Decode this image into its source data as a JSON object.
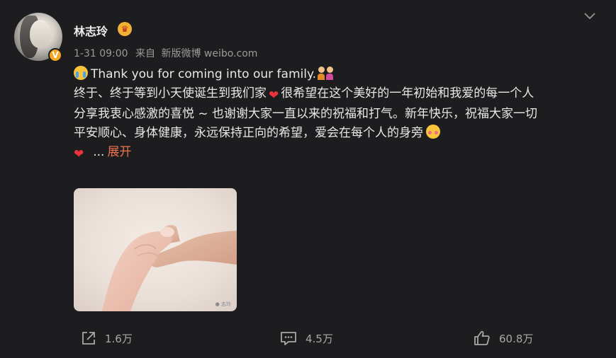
{
  "post": {
    "author": {
      "name": "林志玲",
      "verified_badge": "V",
      "crown_icon": "crown-badge-icon"
    },
    "meta": {
      "time": "1-31 09:00",
      "source_prefix": "来自",
      "source": "新版微博 weibo.com"
    },
    "content": {
      "line1": "Thank you for coming into our family.",
      "line2a": "终于、终于等到小天使诞生到我们家",
      "line2b": "很希望在这个美好的一年初始和我爱的每一个人",
      "line3": "分享我衷心感激的喜悦 ~ 也谢谢大家一直以来的祝福和打气。新年快乐，祝福大家一切",
      "line4": "平安顺心、身体健康，永远保持正向的希望，爱会在每个人的身旁",
      "ellipsis": "...",
      "expand_label": "展开"
    },
    "photo": {
      "watermark": "● 志玲"
    },
    "actions": {
      "share_count": "1.6万",
      "comment_count": "4.5万",
      "like_count": "60.8万"
    }
  },
  "colors": {
    "background": "#1d1d1f",
    "text": "#e8e8e8",
    "muted": "#9a9a9a",
    "link": "#eb7350",
    "verified": "#f5a623"
  }
}
